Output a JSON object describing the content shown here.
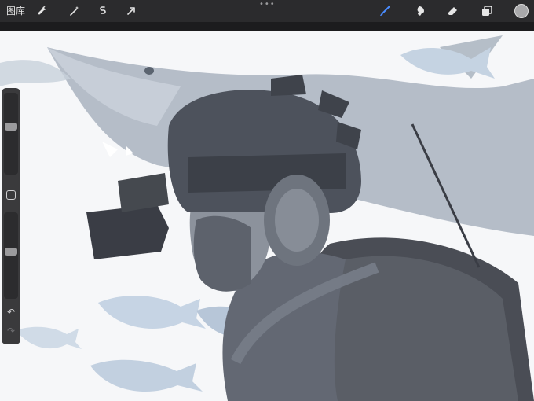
{
  "app": {
    "gallery_label": "图库"
  },
  "toolbar": {
    "left_icons": [
      "wrench-icon",
      "magic-wand-icon",
      "selection-icon",
      "transform-icon"
    ],
    "right_icons": [
      "brush-icon",
      "smudge-icon",
      "eraser-icon",
      "layers-icon"
    ],
    "more_label": "•••",
    "active_tool": "brush",
    "active_color": "#4a8cff",
    "current_color": "#a9a9ab"
  },
  "sidebar": {
    "brush_size_level": 0.6,
    "opacity_level": 0.55
  },
  "canvas": {
    "artwork": "soldier-with-shark-illustration"
  },
  "colors": {
    "toolbar_bg": "#2b2b2d",
    "sidebar_bg": "#3a3a3c",
    "canvas_bg": "#f6f7f9"
  }
}
